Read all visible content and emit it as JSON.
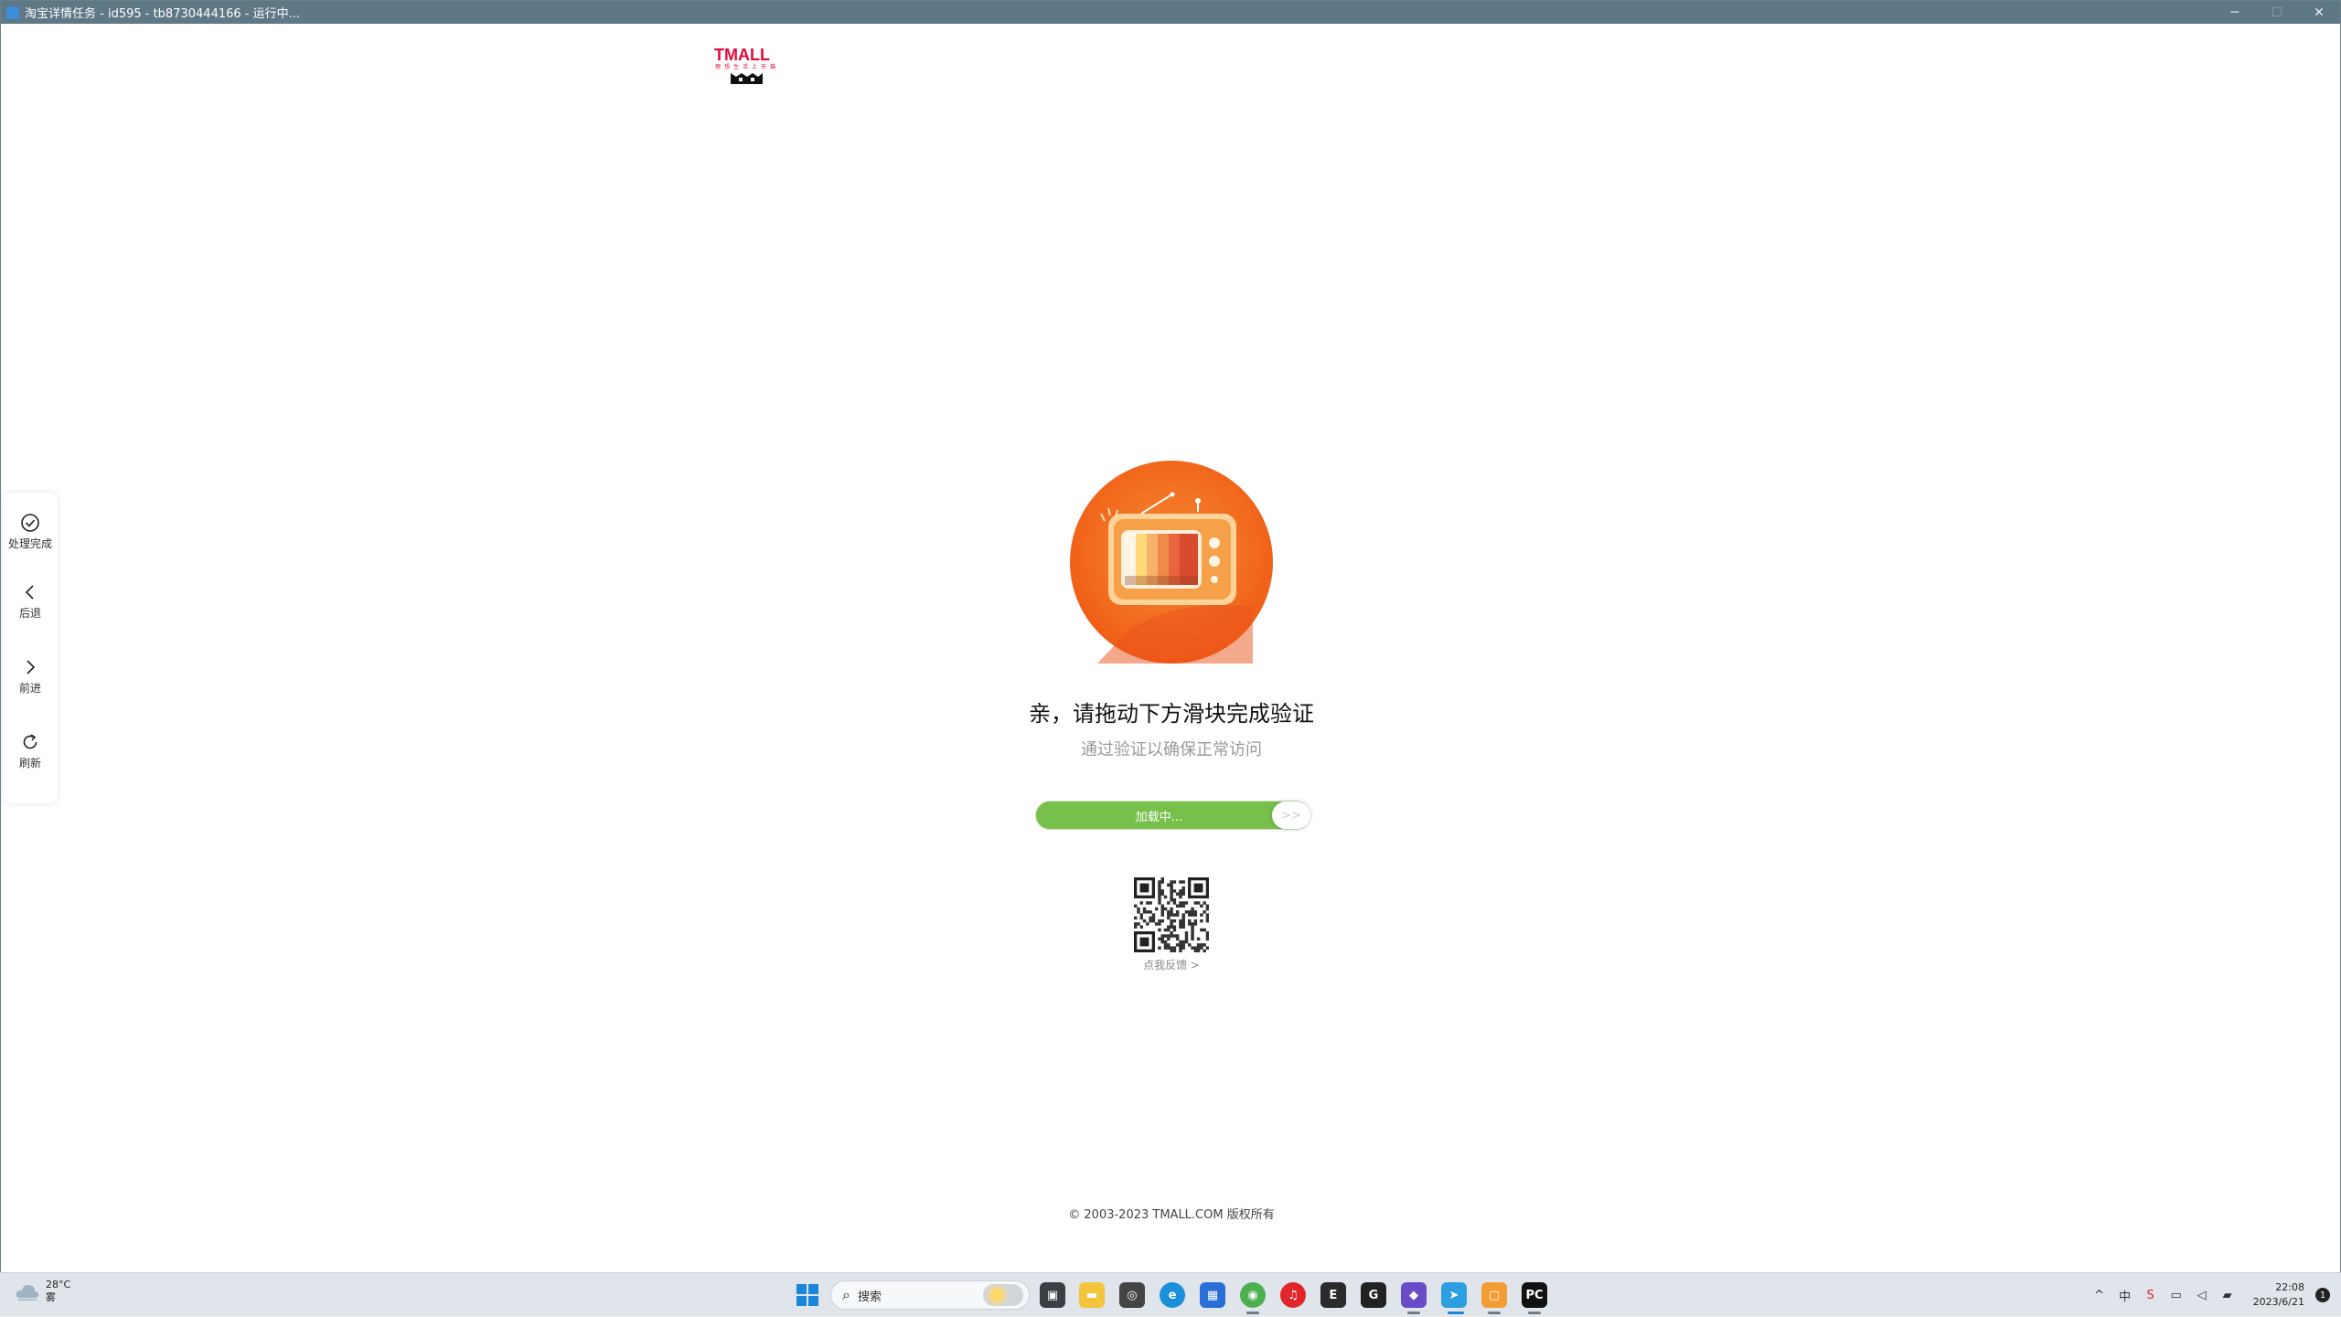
{
  "window": {
    "title": "淘宝详情任务 - id595 - tb8730444166 - 运行中...",
    "minimize": "─",
    "maximize": "☐",
    "close": "✕"
  },
  "logo": {
    "text": "TMALL",
    "sub": "理想生活上天猫",
    "color": "#e5083b"
  },
  "side_nav": [
    {
      "label": "处理完成",
      "icon": "check-circle-icon"
    },
    {
      "label": "后退",
      "icon": "chevron-left-icon"
    },
    {
      "label": "前进",
      "icon": "chevron-right-icon"
    },
    {
      "label": "刷新",
      "icon": "refresh-icon"
    }
  ],
  "verify": {
    "title": "亲，请拖动下方滑块完成验证",
    "subtitle": "通过验证以确保正常访问",
    "slider_text": "加载中...",
    "slider_knob": ">>",
    "progress": 0.9,
    "feedback": "点我反馈 >"
  },
  "footer": {
    "copyright": "© 2003-2023 TMALL.COM 版权所有"
  },
  "taskbar": {
    "weather_temp": "28°C",
    "weather_desc": "雾",
    "search_placeholder": "搜索",
    "clock_time": "22:08",
    "clock_date": "2023/6/21",
    "notification_count": "1",
    "apps": [
      "task-view",
      "file-explorer",
      "store",
      "edge",
      "app",
      "chrome",
      "netease-music",
      "epic-games",
      "app-g",
      "visual-studio",
      "app-bird",
      "app-window",
      "pycharm"
    ]
  },
  "colors": {
    "accent_green": "#76c04b",
    "brand_red": "#e5083b",
    "tv_orange": "#f26b1d"
  }
}
